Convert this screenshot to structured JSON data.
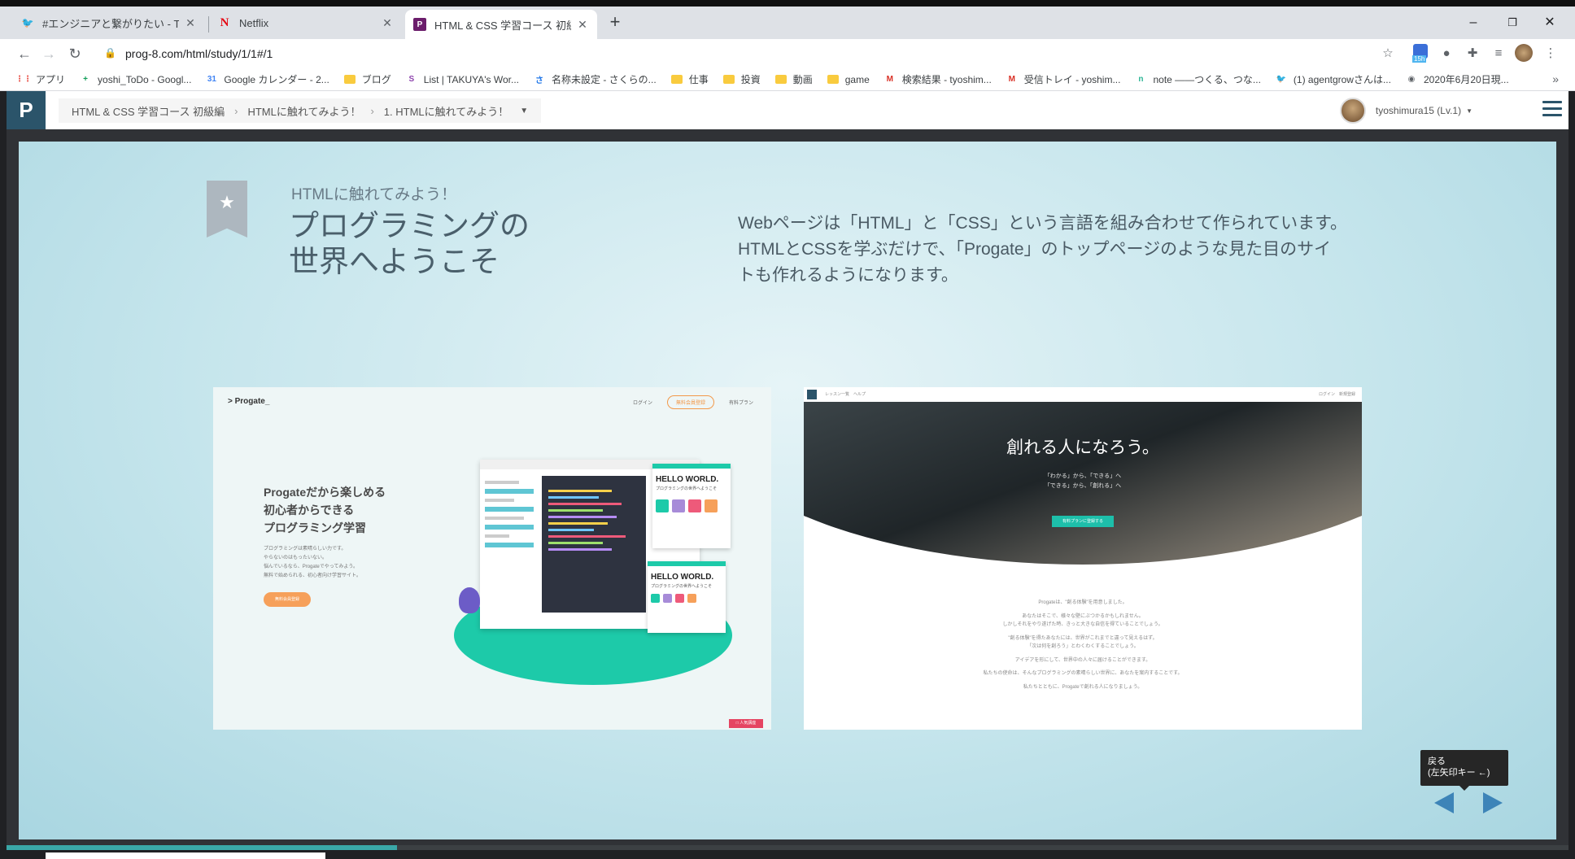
{
  "browser": {
    "tabs": [
      {
        "title": "#エンジニアと繋がりたい - Twitter検索",
        "favicon": "twitter-icon",
        "color": "#1da1f2",
        "glyph": "🐦"
      },
      {
        "title": "Netflix",
        "favicon": "netflix-icon",
        "color": "#e50914",
        "glyph": "N"
      },
      {
        "title": "HTML & CSS 学習コース 初級編 | プログラミングの",
        "favicon": "progate-icon",
        "color": "#6b1d6b",
        "glyph": "P"
      }
    ],
    "url": "prog-8.com/html/study/1/1#/1",
    "bookmarks": [
      {
        "label": "アプリ",
        "icon": "apps-grid-icon"
      },
      {
        "label": "yoshi_ToDo - Googl...",
        "icon": "sheets-icon"
      },
      {
        "label": "Google カレンダー - 2...",
        "icon": "calendar-icon"
      },
      {
        "label": "ブログ",
        "icon": "folder-icon"
      },
      {
        "label": "List | TAKUYA's Wor...",
        "icon": "site-icon"
      },
      {
        "label": "名称未設定 - さくらの...",
        "icon": "sakura-icon"
      },
      {
        "label": "仕事",
        "icon": "folder-icon"
      },
      {
        "label": "投資",
        "icon": "folder-icon"
      },
      {
        "label": "動画",
        "icon": "folder-icon"
      },
      {
        "label": "game",
        "icon": "folder-icon"
      },
      {
        "label": "検索結果 - tyoshim...",
        "icon": "gmail-icon"
      },
      {
        "label": "受信トレイ - yoshim...",
        "icon": "gmail-icon"
      },
      {
        "label": "note ――つくる、つな...",
        "icon": "note-icon"
      },
      {
        "label": "(1) agentgrowさんは...",
        "icon": "twitter-icon"
      },
      {
        "label": "2020年6月20日現...",
        "icon": "globe-icon"
      }
    ],
    "bookmarks_more": "»",
    "window_controls": {
      "minimize": "–",
      "maximize": "❐",
      "close": "✕"
    },
    "ext_badge": "15h"
  },
  "header": {
    "logo": "P",
    "breadcrumb": [
      "HTML & CSS 学習コース 初級編",
      "HTMLに触れてみよう！",
      "1. HTMLに触れてみよう！"
    ],
    "user": "tyoshimura15 (Lv.1)"
  },
  "slide": {
    "chapter": "HTMLに触れてみよう！",
    "title_line1": "プログラミングの",
    "title_line2": "世界へようこそ",
    "desc_line1": "Webページは「HTML」と「CSS」という言語を組み合わせて作られています。",
    "desc_line2": "HTMLとCSSを学ぶだけで、「Progate」のトップページのような見た目のサイトも作れるようになります。",
    "shot1": {
      "brand": "> Progate_",
      "nav_login": "ログイン",
      "nav_signup": "無料会員登録",
      "nav_plan": "有料プラン",
      "heading1": "Progateだから楽しめる",
      "heading2": "初心者からできる",
      "heading3": "プログラミング学習",
      "sub1": "プログラミングは素晴らしい力です。",
      "sub2": "やらないのはもったいない。",
      "sub3": "悩んでいるなら、Progateでやってみよう。",
      "sub4": "無料で始められる、初心者向け学習サイト。",
      "cta": "無料会員登録",
      "hello": "HELLO WORLD.",
      "hello_sub": "プログラミングの世界へようこそ",
      "badge": "□ 人気講座"
    },
    "shot2": {
      "nav_left": "レッスン一覧　ヘルプ",
      "nav_right": "ログイン　新規登録",
      "hero_title": "創れる人になろう。",
      "hero_sub1": "「わかる」から、「できる」へ",
      "hero_sub2": "「できる」から、「創れる」へ",
      "hero_button": "有料プランに登録する",
      "body": [
        "Progateは、\"創る体験\"を用意しました。",
        "",
        "あなたはそこで、様々な壁にぶつかるかもしれません。",
        "しかしそれをやり遂げた時、きっと大きな自信を得ていることでしょう。",
        "",
        "\"創る体験\"を得たあなたには、世界がこれまでと違って見えるはず。",
        "「次は何を創ろう」とわくわくすることでしょう。",
        "",
        "アイデアを形にして、世界中の人々に届けることができます。",
        "",
        "私たちの使命は、そんなプログラミングの素晴らしい世界に、あなたを案内することです。",
        "",
        "私たちとともに、Progateで創れる人になりましょう。"
      ]
    },
    "tooltip_line1": "戻る",
    "tooltip_line2": "(左矢印キー ←)",
    "progress": 0.25
  }
}
